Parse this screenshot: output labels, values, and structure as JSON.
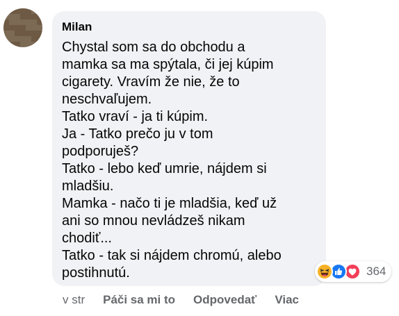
{
  "comment": {
    "author": "Milan",
    "lines": [
      "Chystal som sa do obchodu a",
      "mamka sa ma spýtala, či jej kúpim",
      "cigarety. Vravím že nie, že to",
      "neschvaľujem.",
      "Tatko vraví - ja ti kúpim.",
      "Ja - Tatko prečo ju v tom",
      "podporuješ?",
      "Tatko - lebo keď umrie, nájdem si",
      "mladšiu.",
      "Mamka - načo ti je mladšia, keď už",
      "ani so mnou nevládzeš nikam",
      "chodiť...",
      "Tatko - tak si nájdem chromú, alebo",
      "postihnutú."
    ]
  },
  "reactions": {
    "icons": [
      "haha-icon",
      "like-icon",
      "love-icon"
    ],
    "count": "364"
  },
  "actions": {
    "timestamp": "v str",
    "like": "Páči sa mi to",
    "reply": "Odpovedať",
    "more": "Viac"
  },
  "colors": {
    "bubble": "#f0f2f5",
    "meta_text": "#65676b",
    "like_blue": "#1877f2",
    "love_red": "#f33e58",
    "haha_yellow": "#f7b125"
  }
}
